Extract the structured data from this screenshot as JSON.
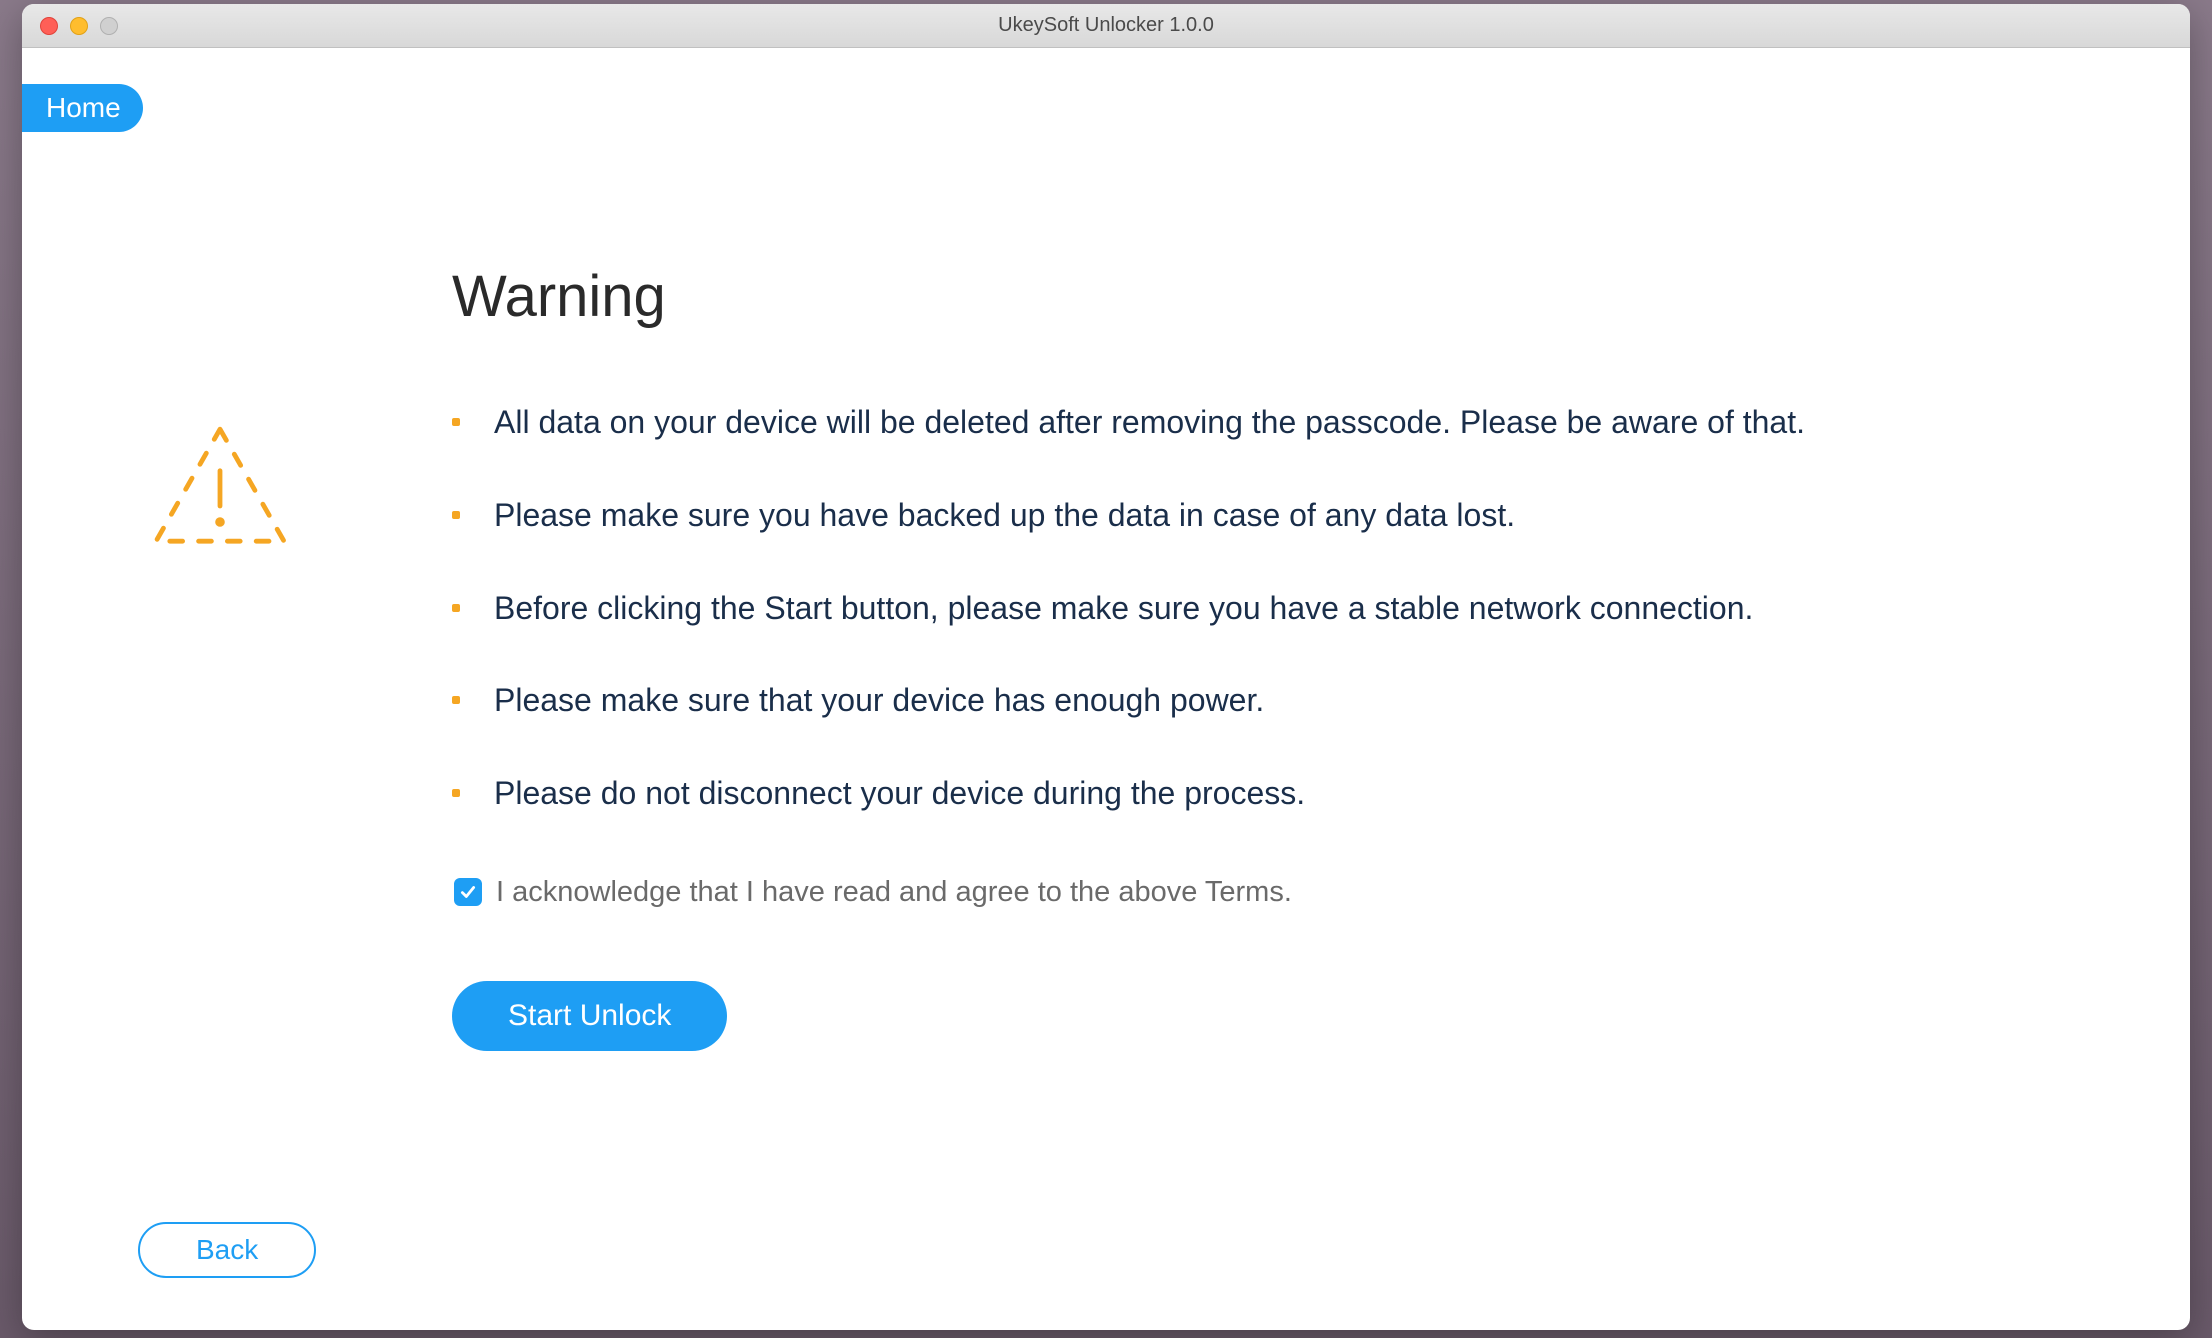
{
  "window": {
    "title": "UkeySoft Unlocker 1.0.0"
  },
  "nav": {
    "home_label": "Home"
  },
  "main": {
    "heading": "Warning",
    "bullets": [
      "All data on your device will be deleted after removing the passcode. Please be aware of that.",
      "Please make sure you have backed up the data in case of any data lost.",
      "Before clicking the Start button, please make sure you have a stable network connection.",
      "Please make sure that your device has enough power.",
      "Please do not disconnect your device during the process."
    ],
    "acknowledge": {
      "checked": true,
      "label": "I acknowledge that I have read and agree to the above Terms."
    },
    "start_label": "Start Unlock"
  },
  "footer": {
    "back_label": "Back"
  },
  "colors": {
    "accent": "#1e9ef4",
    "warning_icon": "#f5a623",
    "text_body": "#1a2e4a"
  }
}
